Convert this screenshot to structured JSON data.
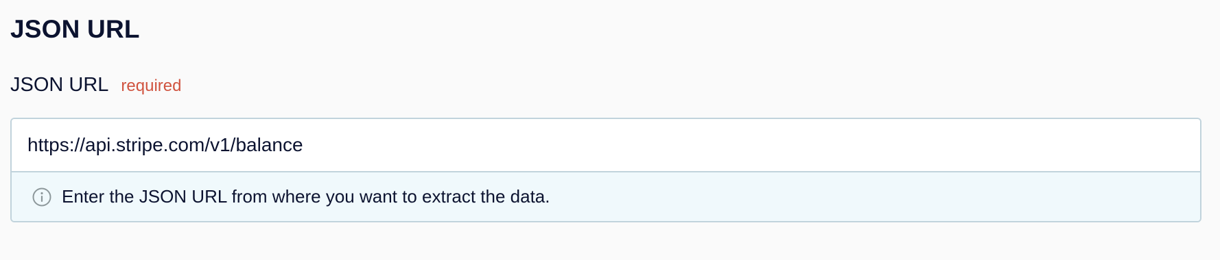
{
  "section": {
    "title": "JSON URL"
  },
  "field": {
    "label": "JSON URL",
    "required_label": "required",
    "value": "https://api.stripe.com/v1/balance",
    "help_icon": "info-icon",
    "help_text": "Enter the JSON URL from where you want to extract the data."
  },
  "colors": {
    "required": "#d0533f",
    "border": "#c1d3dc",
    "help_background": "#f0f9fc"
  }
}
